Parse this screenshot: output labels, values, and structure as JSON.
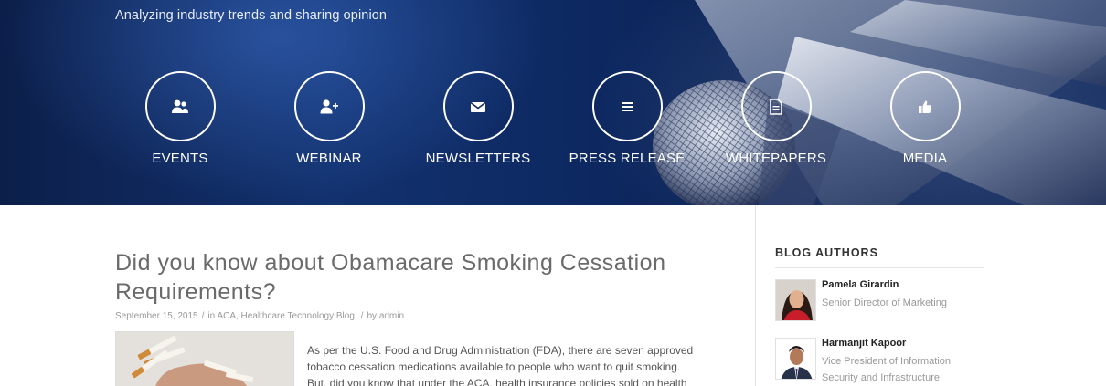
{
  "header": {
    "tagline": "Analyzing industry trends and sharing opinion"
  },
  "hero_nav": {
    "items": [
      {
        "label": "EVENTS",
        "icon": "users-icon"
      },
      {
        "label": "WEBINAR",
        "icon": "user-plus-icon"
      },
      {
        "label": "NEWSLETTERS",
        "icon": "envelope-icon"
      },
      {
        "label": "PRESS RELEASE",
        "icon": "list-icon"
      },
      {
        "label": "WHITEPAPERS",
        "icon": "document-icon"
      },
      {
        "label": "MEDIA",
        "icon": "thumbs-up-icon"
      }
    ]
  },
  "post": {
    "title": "Did you know about Obamacare Smoking Cessation Requirements?",
    "date": "September 15, 2015",
    "in_prefix": "in",
    "categories": "ACA, Healthcare Technology Blog",
    "by_prefix": "by",
    "author": "admin",
    "excerpt_line1": "As per the U.S. Food and Drug Administration (FDA), there are seven approved",
    "excerpt_line2": "tobacco cessation medications available to people who want to quit smoking.",
    "excerpt_line3": "But, did you know that under the ACA, health insurance policies sold on health"
  },
  "sidebar": {
    "title": "BLOG AUTHORS",
    "authors": [
      {
        "name": "Pamela Girardin",
        "role": "Senior Director of Marketing"
      },
      {
        "name": "Harmanjit Kapoor",
        "role": "Vice President of Information Security and Infrastructure"
      }
    ]
  },
  "colors": {
    "hero_bg": "#0d2860",
    "nav_white": "#ffffff",
    "title_gray": "#6a6a6a",
    "meta_gray": "#9a9a9a"
  }
}
